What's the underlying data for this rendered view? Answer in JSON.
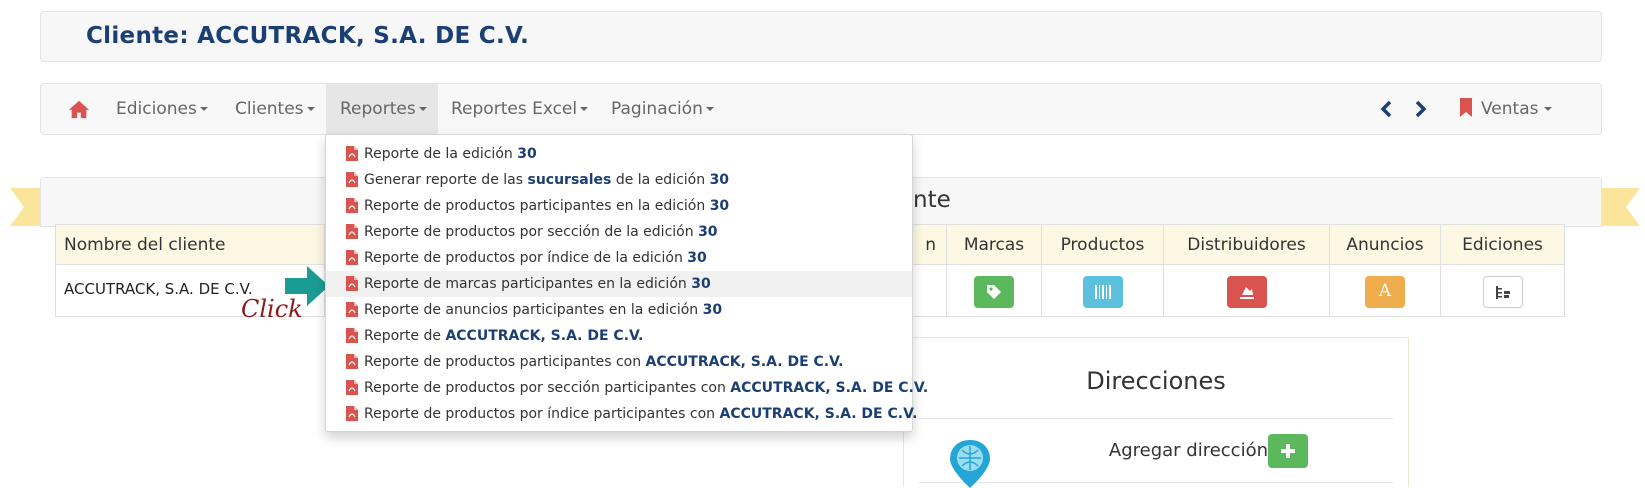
{
  "header": {
    "title": "Cliente: ACCUTRACK, S.A. DE C.V."
  },
  "navbar": {
    "home_icon": "home-icon",
    "items": [
      {
        "label": "Ediciones"
      },
      {
        "label": "Clientes"
      },
      {
        "label": "Reportes"
      },
      {
        "label": "Reportes Excel"
      },
      {
        "label": "Paginación"
      }
    ],
    "prev_icon": "chevron-left-icon",
    "next_icon": "chevron-right-icon",
    "ventas_label": "Ventas",
    "bookmark_icon": "bookmark-icon"
  },
  "dropdown": {
    "icon": "pdf-file-icon",
    "items": [
      {
        "pre": "Reporte de la edición ",
        "b1": "30",
        "mid": "",
        "b2": ""
      },
      {
        "pre": "Generar reporte de las ",
        "b1": "sucursales",
        "mid": " de la edición ",
        "b2": "30"
      },
      {
        "pre": "Reporte de productos participantes en la edición ",
        "b1": "30",
        "mid": "",
        "b2": ""
      },
      {
        "pre": "Reporte de productos por sección de la edición ",
        "b1": "30",
        "mid": "",
        "b2": ""
      },
      {
        "pre": "Reporte de productos por índice de la edición ",
        "b1": "30",
        "mid": "",
        "b2": ""
      },
      {
        "pre": "Reporte de marcas participantes en la edición ",
        "b1": "30",
        "mid": "",
        "b2": ""
      },
      {
        "pre": "Reporte de anuncios participantes en la edición ",
        "b1": "30",
        "mid": "",
        "b2": ""
      },
      {
        "pre": "Reporte de ",
        "b1": "ACCUTRACK, S.A. DE C.V.",
        "mid": "",
        "b2": ""
      },
      {
        "pre": "Reporte de productos participantes con ",
        "b1": "ACCUTRACK, S.A. DE C.V.",
        "mid": "",
        "b2": ""
      },
      {
        "pre": "Reporte de productos por sección participantes con ",
        "b1": "ACCUTRACK, S.A. DE C.V.",
        "mid": "",
        "b2": ""
      },
      {
        "pre": "Reporte de productos por índice participantes con ",
        "b1": "ACCUTRACK, S.A. DE C.V.",
        "mid": "",
        "b2": ""
      }
    ],
    "highlighted_index": 5
  },
  "panel": {
    "title_visible_tail": "nte"
  },
  "table": {
    "headers": {
      "nombre": "Nombre del cliente",
      "partial": "n",
      "marcas": "Marcas",
      "productos": "Productos",
      "distribuidores": "Distribuidores",
      "anuncios": "Anuncios",
      "ediciones": "Ediciones"
    },
    "row": {
      "nombre": "ACCUTRACK, S.A. DE C.V."
    },
    "buttons": {
      "marcas": {
        "icon": "tag-icon",
        "color": "#5cb85c"
      },
      "productos": {
        "icon": "barcode-icon",
        "color": "#5bc0de"
      },
      "distribuidores": {
        "icon": "truck-icon",
        "color": "#d9534f"
      },
      "anuncios": {
        "icon": "font-letter-icon",
        "glyph": "A",
        "color": "#f0ad4e"
      },
      "ediciones": {
        "icon": "tree-icon",
        "color": "#ffffff"
      }
    }
  },
  "annotation": {
    "click_label": "Click",
    "arrow_color": "#1a9c94"
  },
  "direcciones": {
    "title": "Direcciones",
    "add_label": "Agregar dirección",
    "add_icon": "plus-icon",
    "pin_icon": "map-pin-icon"
  },
  "colors": {
    "brand_blue": "#1c3f73",
    "pdf_red": "#d9534f",
    "ribbon": "#fbe59a"
  }
}
